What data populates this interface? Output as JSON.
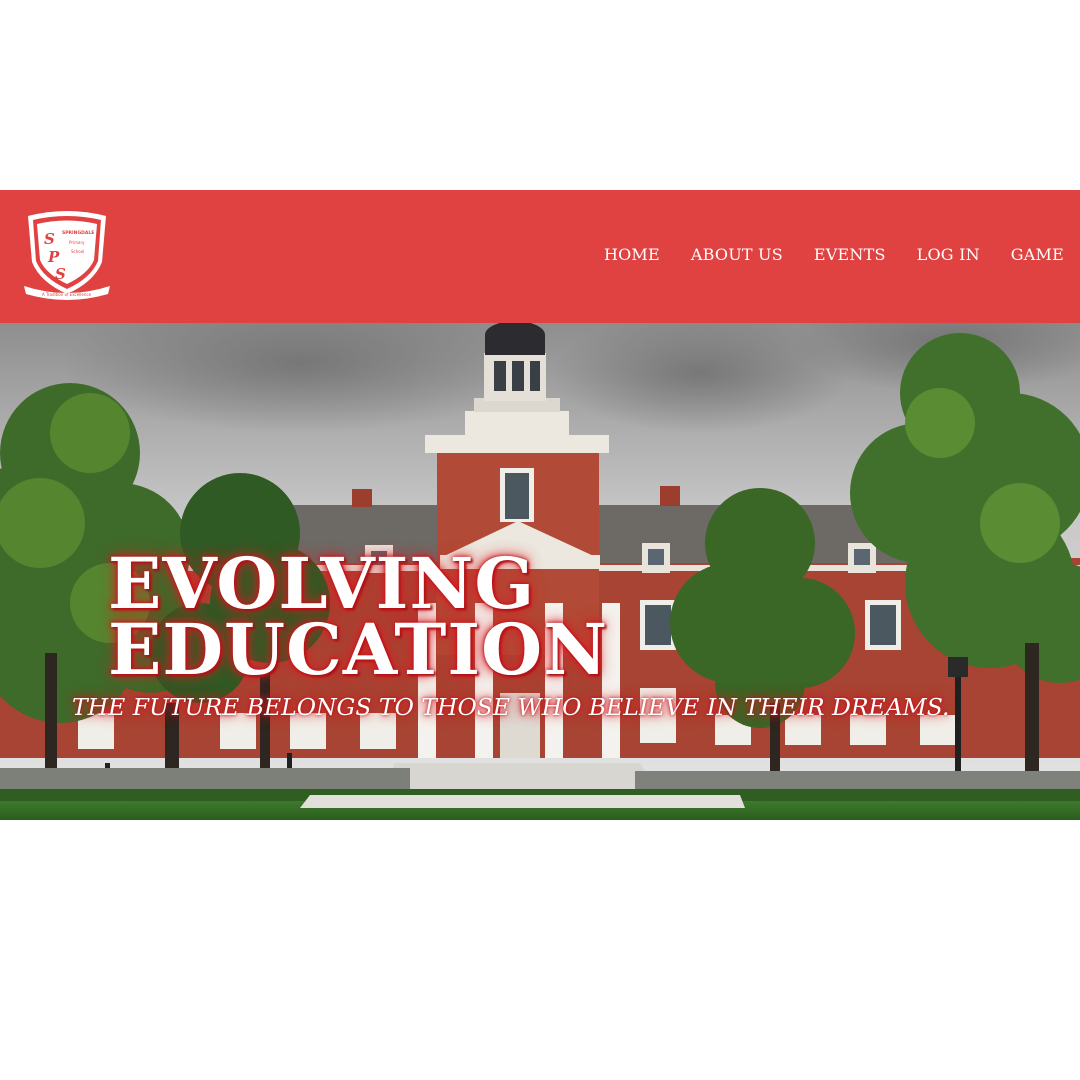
{
  "brand": {
    "logo_initials": "SPS",
    "logo_school_line1": "SPRINGDALE",
    "logo_school_line2": "Primary",
    "logo_school_line3": "School",
    "logo_motto": "A Tradition of Excellence",
    "color": "#e04242"
  },
  "nav": {
    "items": [
      {
        "label": "HOME"
      },
      {
        "label": "ABOUT US"
      },
      {
        "label": "EVENTS"
      },
      {
        "label": "LOG IN"
      },
      {
        "label": "GAME"
      }
    ]
  },
  "hero": {
    "title_line1": "EVOLVING",
    "title_line2": "EDUCATION",
    "tagline": "THE FUTURE BELONGS TO THOSE WHO BELIEVE IN THEIR DREAMS."
  }
}
